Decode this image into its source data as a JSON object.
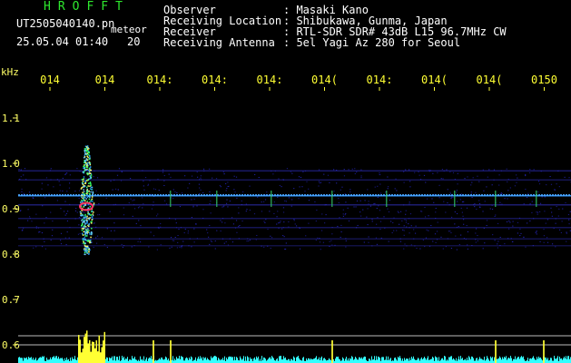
{
  "header": {
    "logo": "HROFFT",
    "filename": "UT2505040140.pn",
    "meteor_label": "meteor",
    "date_time": "25.05.04 01:40",
    "meteor_count": "20",
    "fields": [
      {
        "label": "Observer",
        "value": ": Masaki Kano"
      },
      {
        "label": "Receiving Location",
        "value": ": Shibukawa, Gunma, Japan"
      },
      {
        "label": "Receiver",
        "value": ": RTL-SDR SDR# 43dB L15 96.7MHz CW"
      },
      {
        "label": "Receiving Antenna",
        "value": ": 5el Yagi Az 280 for Seoul"
      }
    ]
  },
  "colors": {
    "background": "#000000",
    "header_text": "#ffffff",
    "logo": "#2ee82e",
    "tick_text": "#ffff33",
    "noise_line": "#3333cc",
    "signal_line": "#3399ff",
    "meteor_hot": "#ff3366",
    "meteor_mid": "#33ff66",
    "histogram_base": "#33ffff",
    "histogram_peak": "#ffff33"
  },
  "chart_data": {
    "type": "heatmap",
    "y_unit": "kHz",
    "y_ticks": [
      "1.1",
      "1.0",
      "0.9",
      "0.8",
      "0.7",
      "0.6"
    ],
    "x_ticks": [
      "014",
      "014",
      "014:",
      "014:",
      "014:",
      "014(",
      "014:",
      "014(",
      "014(",
      "0150"
    ],
    "meteor_time_index": 1.2,
    "carrier_khz": 0.93
  }
}
